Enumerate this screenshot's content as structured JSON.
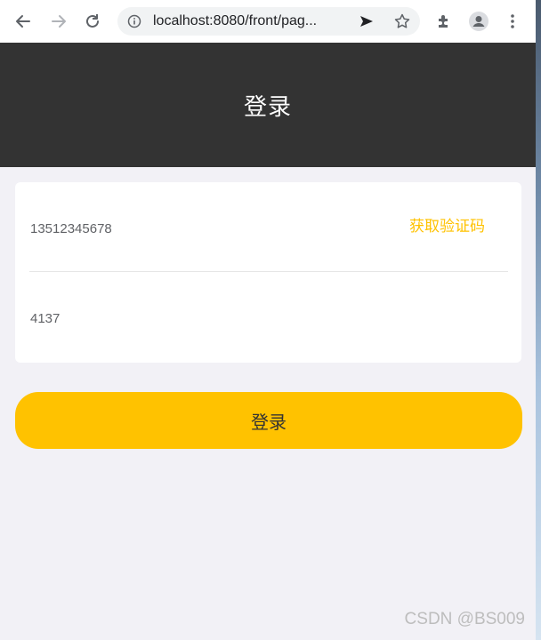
{
  "browser": {
    "url": "localhost:8080/front/pag...",
    "icons": [
      "back-icon",
      "forward-icon",
      "reload-icon",
      "info-icon",
      "send-icon",
      "star-icon",
      "extensions-icon",
      "profile-icon",
      "menu-icon"
    ]
  },
  "header": {
    "title": "登录"
  },
  "form": {
    "phone_value": "13512345678",
    "get_code_label": "获取验证码",
    "code_value": "4137"
  },
  "login_button_label": "登录",
  "watermark": "CSDN @BS009",
  "colors": {
    "header_bg": "#333333",
    "accent": "#ffc200",
    "page_bg": "#f2f1f6"
  }
}
